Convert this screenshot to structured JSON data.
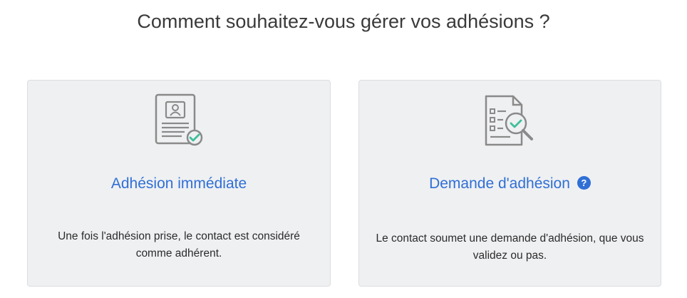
{
  "page": {
    "title": "Comment souhaitez-vous gérer vos adhésions ?"
  },
  "options": [
    {
      "title": "Adhésion immédiate",
      "description": "Une fois l'adhésion prise, le contact est considéré comme adhérent.",
      "icon": "member-card-check-icon"
    },
    {
      "title": "Demande d'adhésion",
      "description": "Le contact soumet une demande d'adhésion, que vous validez ou pas.",
      "icon": "document-search-check-icon",
      "help_icon": "?"
    }
  ],
  "colors": {
    "accent": "#2f6fd6",
    "card_background": "#eff0f2",
    "check_green": "#3fbf9a",
    "icon_gray": "#8a8a8a"
  }
}
